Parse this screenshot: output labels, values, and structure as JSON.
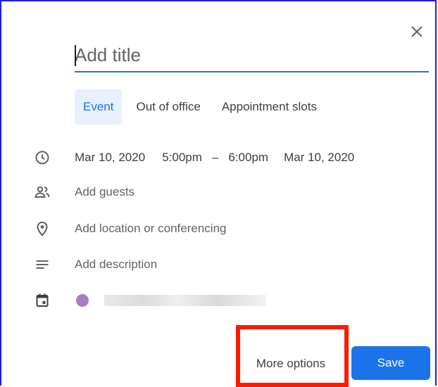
{
  "dialog": {
    "title_placeholder": "Add title",
    "tabs": [
      {
        "label": "Event",
        "active": true
      },
      {
        "label": "Out of office",
        "active": false
      },
      {
        "label": "Appointment slots",
        "active": false
      }
    ],
    "datetime": {
      "start_date": "Mar 10, 2020",
      "start_time": "5:00pm",
      "separator": "–",
      "end_time": "6:00pm",
      "end_date": "Mar 10, 2020"
    },
    "guests_placeholder": "Add guests",
    "location_placeholder": "Add location or conferencing",
    "description_placeholder": "Add description",
    "calendar_color": "#a67ec3",
    "buttons": {
      "more_options": "More options",
      "save": "Save"
    }
  },
  "colors": {
    "accent": "#1a73e8",
    "highlight_box": "#ff1a00"
  },
  "icons": [
    "close-icon",
    "clock-icon",
    "people-icon",
    "location-pin-icon",
    "description-lines-icon",
    "calendar-icon"
  ]
}
